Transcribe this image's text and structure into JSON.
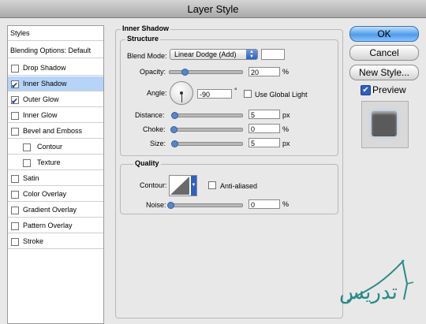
{
  "window": {
    "title": "Layer Style"
  },
  "styles_list": {
    "header": "Styles",
    "blending_options": "Blending Options: Default",
    "items": [
      {
        "label": "Drop Shadow",
        "checked": false,
        "selected": false,
        "sub": false
      },
      {
        "label": "Inner Shadow",
        "checked": true,
        "selected": true,
        "sub": false
      },
      {
        "label": "Outer Glow",
        "checked": true,
        "selected": false,
        "sub": false
      },
      {
        "label": "Inner Glow",
        "checked": false,
        "selected": false,
        "sub": false
      },
      {
        "label": "Bevel and Emboss",
        "checked": false,
        "selected": false,
        "sub": false
      },
      {
        "label": "Contour",
        "checked": false,
        "selected": false,
        "sub": true
      },
      {
        "label": "Texture",
        "checked": false,
        "selected": false,
        "sub": true
      },
      {
        "label": "Satin",
        "checked": false,
        "selected": false,
        "sub": false
      },
      {
        "label": "Color Overlay",
        "checked": false,
        "selected": false,
        "sub": false
      },
      {
        "label": "Gradient Overlay",
        "checked": false,
        "selected": false,
        "sub": false
      },
      {
        "label": "Pattern Overlay",
        "checked": false,
        "selected": false,
        "sub": false
      },
      {
        "label": "Stroke",
        "checked": false,
        "selected": false,
        "sub": false
      }
    ]
  },
  "inner_shadow": {
    "title": "Inner Shadow",
    "structure": {
      "title": "Structure",
      "blend_mode_label": "Blend Mode:",
      "blend_mode_value": "Linear Dodge (Add)",
      "opacity_label": "Opacity:",
      "opacity_value": "20",
      "opacity_fraction": 0.2,
      "percent": "%",
      "angle_label": "Angle:",
      "angle_value": "-90",
      "degree": "°",
      "global_light_label": "Use Global Light",
      "distance_label": "Distance:",
      "distance_value": "5",
      "choke_label": "Choke:",
      "choke_value": "0",
      "size_label": "Size:",
      "size_value": "5",
      "px": "px"
    },
    "quality": {
      "title": "Quality",
      "contour_label": "Contour:",
      "anti_aliased_label": "Anti-aliased",
      "noise_label": "Noise:",
      "noise_value": "0",
      "percent": "%"
    }
  },
  "buttons": {
    "ok": "OK",
    "cancel": "Cancel",
    "new_style": "New Style...",
    "preview": "Preview"
  },
  "watermark": {
    "text": "تدریس"
  },
  "colors": {
    "selection": "#b5d4f7",
    "accent": "#4f9be8",
    "watermark": "#2a8a8a"
  }
}
